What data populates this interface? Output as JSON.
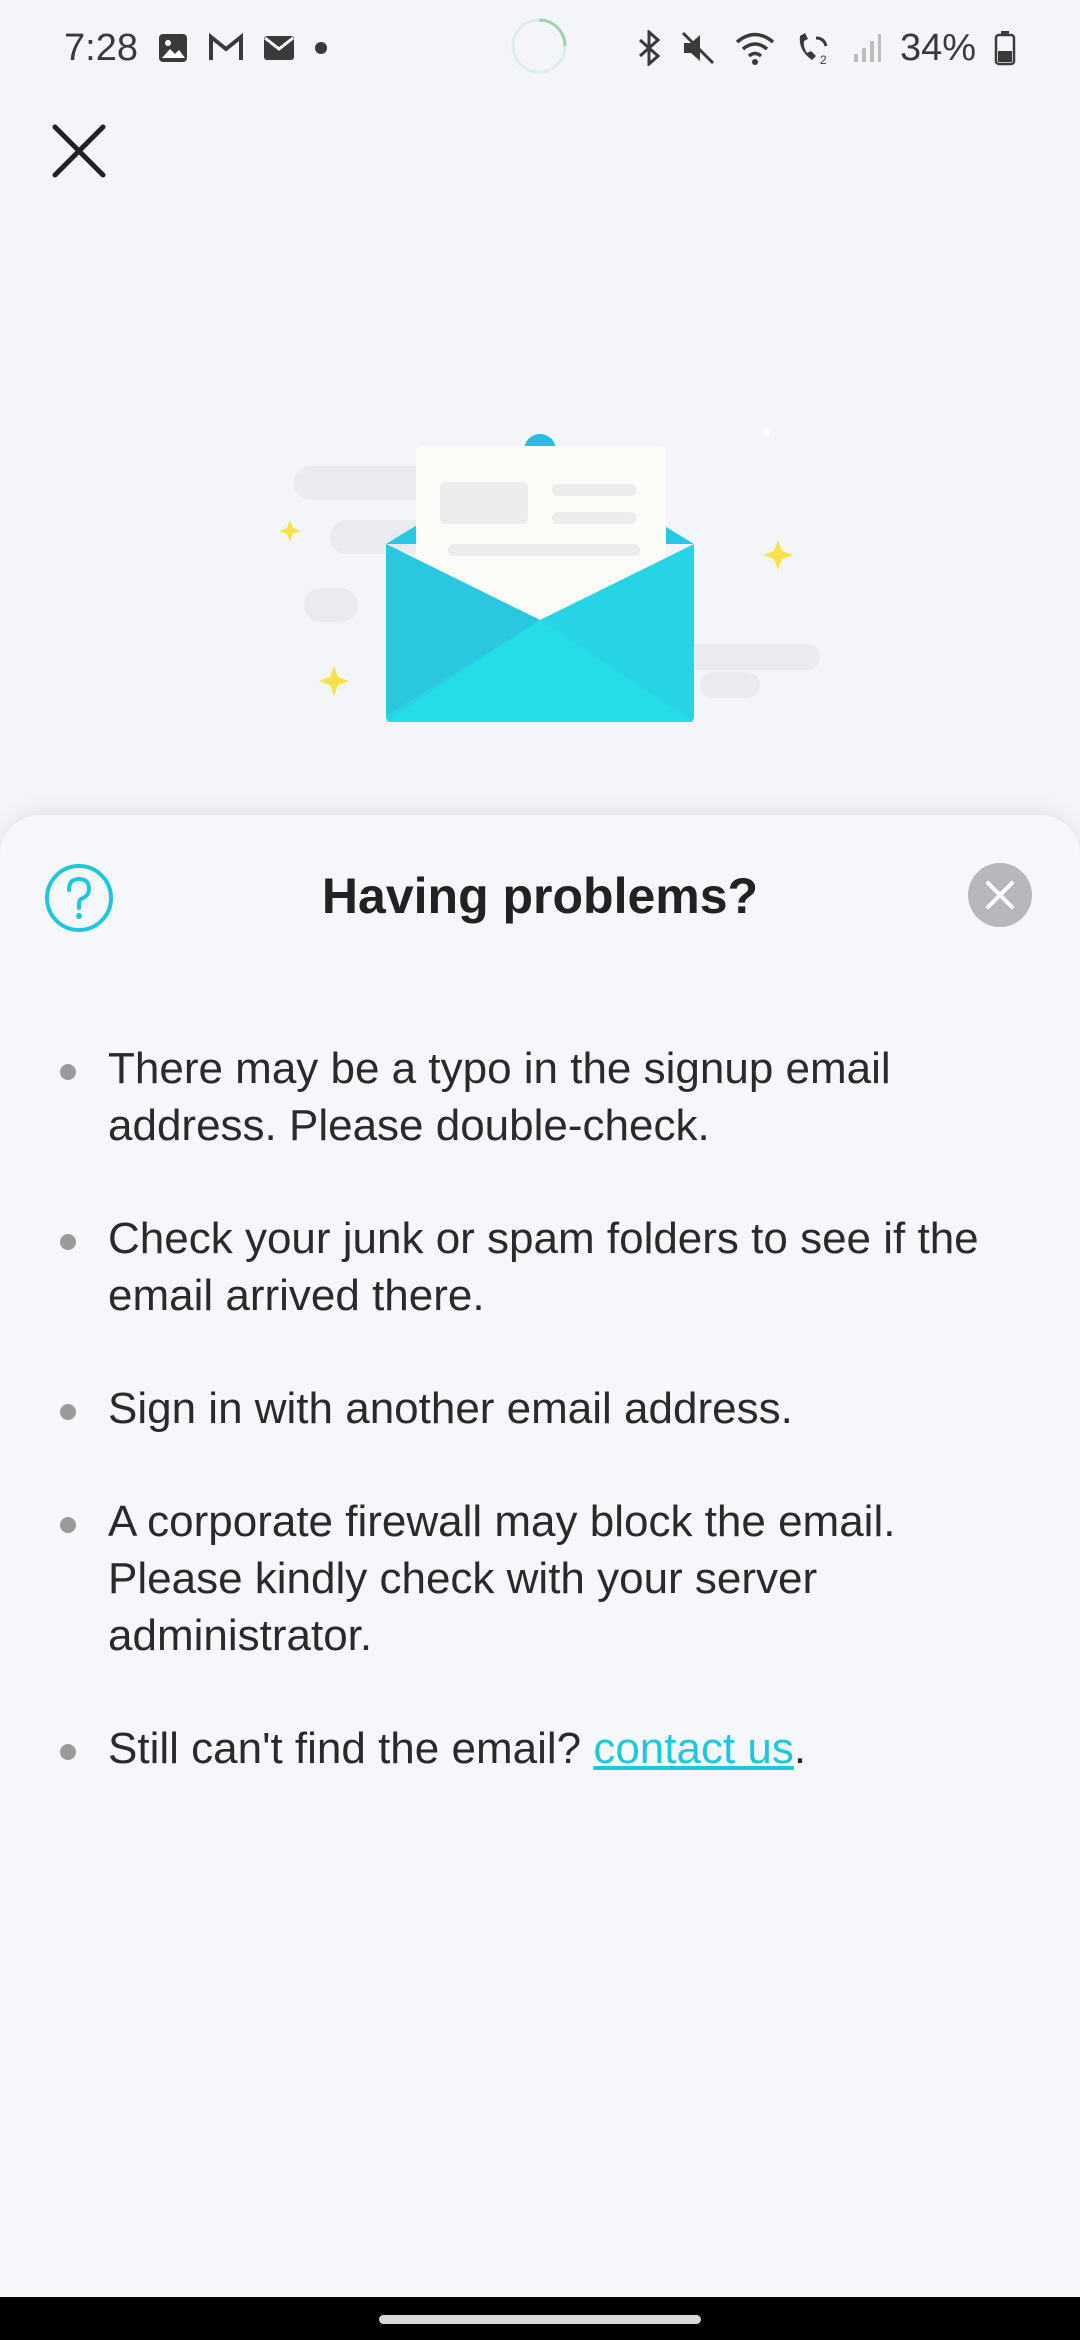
{
  "status_bar": {
    "time": "7:28",
    "battery": "34%",
    "left_icons": [
      "gallery-icon",
      "gmail-icon",
      "mail-icon",
      "dot-icon"
    ],
    "right_icons": [
      "bluetooth-icon",
      "mute-icon",
      "wifi-icon",
      "wifi-call-icon",
      "signal-icon",
      "battery-icon"
    ]
  },
  "sheet": {
    "title": "Having problems?",
    "tips": [
      "There may be a typo in the signup email address. Please double-check.",
      "Check your junk or spam folders to see if the email arrived there.",
      "Sign in with another email address.",
      "A corporate firewall may block the email. Please kindly check with your server administrator."
    ],
    "last_tip": {
      "prefix": "Still can't find the email? ",
      "link": "contact us",
      "suffix": "."
    }
  },
  "colors": {
    "accent": "#1ec7dc",
    "envelope": "#26d4e6",
    "sparkle": "#f8e24a",
    "background": "#f3f5f9"
  }
}
